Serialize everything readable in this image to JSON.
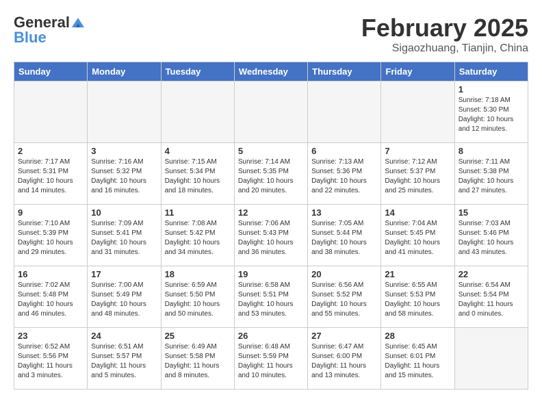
{
  "header": {
    "logo": {
      "general": "General",
      "blue": "Blue"
    },
    "title": "February 2025",
    "location": "Sigaozhuang, Tianjin, China"
  },
  "days_of_week": [
    "Sunday",
    "Monday",
    "Tuesday",
    "Wednesday",
    "Thursday",
    "Friday",
    "Saturday"
  ],
  "weeks": [
    [
      {
        "day": null
      },
      {
        "day": null
      },
      {
        "day": null
      },
      {
        "day": null
      },
      {
        "day": null
      },
      {
        "day": null
      },
      {
        "day": 1,
        "sunrise": "7:18 AM",
        "sunset": "5:30 PM",
        "daylight": "10 hours and 12 minutes."
      }
    ],
    [
      {
        "day": 2,
        "sunrise": "7:17 AM",
        "sunset": "5:31 PM",
        "daylight": "10 hours and 14 minutes."
      },
      {
        "day": 3,
        "sunrise": "7:16 AM",
        "sunset": "5:32 PM",
        "daylight": "10 hours and 16 minutes."
      },
      {
        "day": 4,
        "sunrise": "7:15 AM",
        "sunset": "5:34 PM",
        "daylight": "10 hours and 18 minutes."
      },
      {
        "day": 5,
        "sunrise": "7:14 AM",
        "sunset": "5:35 PM",
        "daylight": "10 hours and 20 minutes."
      },
      {
        "day": 6,
        "sunrise": "7:13 AM",
        "sunset": "5:36 PM",
        "daylight": "10 hours and 22 minutes."
      },
      {
        "day": 7,
        "sunrise": "7:12 AM",
        "sunset": "5:37 PM",
        "daylight": "10 hours and 25 minutes."
      },
      {
        "day": 8,
        "sunrise": "7:11 AM",
        "sunset": "5:38 PM",
        "daylight": "10 hours and 27 minutes."
      }
    ],
    [
      {
        "day": 9,
        "sunrise": "7:10 AM",
        "sunset": "5:39 PM",
        "daylight": "10 hours and 29 minutes."
      },
      {
        "day": 10,
        "sunrise": "7:09 AM",
        "sunset": "5:41 PM",
        "daylight": "10 hours and 31 minutes."
      },
      {
        "day": 11,
        "sunrise": "7:08 AM",
        "sunset": "5:42 PM",
        "daylight": "10 hours and 34 minutes."
      },
      {
        "day": 12,
        "sunrise": "7:06 AM",
        "sunset": "5:43 PM",
        "daylight": "10 hours and 36 minutes."
      },
      {
        "day": 13,
        "sunrise": "7:05 AM",
        "sunset": "5:44 PM",
        "daylight": "10 hours and 38 minutes."
      },
      {
        "day": 14,
        "sunrise": "7:04 AM",
        "sunset": "5:45 PM",
        "daylight": "10 hours and 41 minutes."
      },
      {
        "day": 15,
        "sunrise": "7:03 AM",
        "sunset": "5:46 PM",
        "daylight": "10 hours and 43 minutes."
      }
    ],
    [
      {
        "day": 16,
        "sunrise": "7:02 AM",
        "sunset": "5:48 PM",
        "daylight": "10 hours and 46 minutes."
      },
      {
        "day": 17,
        "sunrise": "7:00 AM",
        "sunset": "5:49 PM",
        "daylight": "10 hours and 48 minutes."
      },
      {
        "day": 18,
        "sunrise": "6:59 AM",
        "sunset": "5:50 PM",
        "daylight": "10 hours and 50 minutes."
      },
      {
        "day": 19,
        "sunrise": "6:58 AM",
        "sunset": "5:51 PM",
        "daylight": "10 hours and 53 minutes."
      },
      {
        "day": 20,
        "sunrise": "6:56 AM",
        "sunset": "5:52 PM",
        "daylight": "10 hours and 55 minutes."
      },
      {
        "day": 21,
        "sunrise": "6:55 AM",
        "sunset": "5:53 PM",
        "daylight": "10 hours and 58 minutes."
      },
      {
        "day": 22,
        "sunrise": "6:54 AM",
        "sunset": "5:54 PM",
        "daylight": "11 hours and 0 minutes."
      }
    ],
    [
      {
        "day": 23,
        "sunrise": "6:52 AM",
        "sunset": "5:56 PM",
        "daylight": "11 hours and 3 minutes."
      },
      {
        "day": 24,
        "sunrise": "6:51 AM",
        "sunset": "5:57 PM",
        "daylight": "11 hours and 5 minutes."
      },
      {
        "day": 25,
        "sunrise": "6:49 AM",
        "sunset": "5:58 PM",
        "daylight": "11 hours and 8 minutes."
      },
      {
        "day": 26,
        "sunrise": "6:48 AM",
        "sunset": "5:59 PM",
        "daylight": "11 hours and 10 minutes."
      },
      {
        "day": 27,
        "sunrise": "6:47 AM",
        "sunset": "6:00 PM",
        "daylight": "11 hours and 13 minutes."
      },
      {
        "day": 28,
        "sunrise": "6:45 AM",
        "sunset": "6:01 PM",
        "daylight": "11 hours and 15 minutes."
      },
      {
        "day": null
      }
    ]
  ]
}
